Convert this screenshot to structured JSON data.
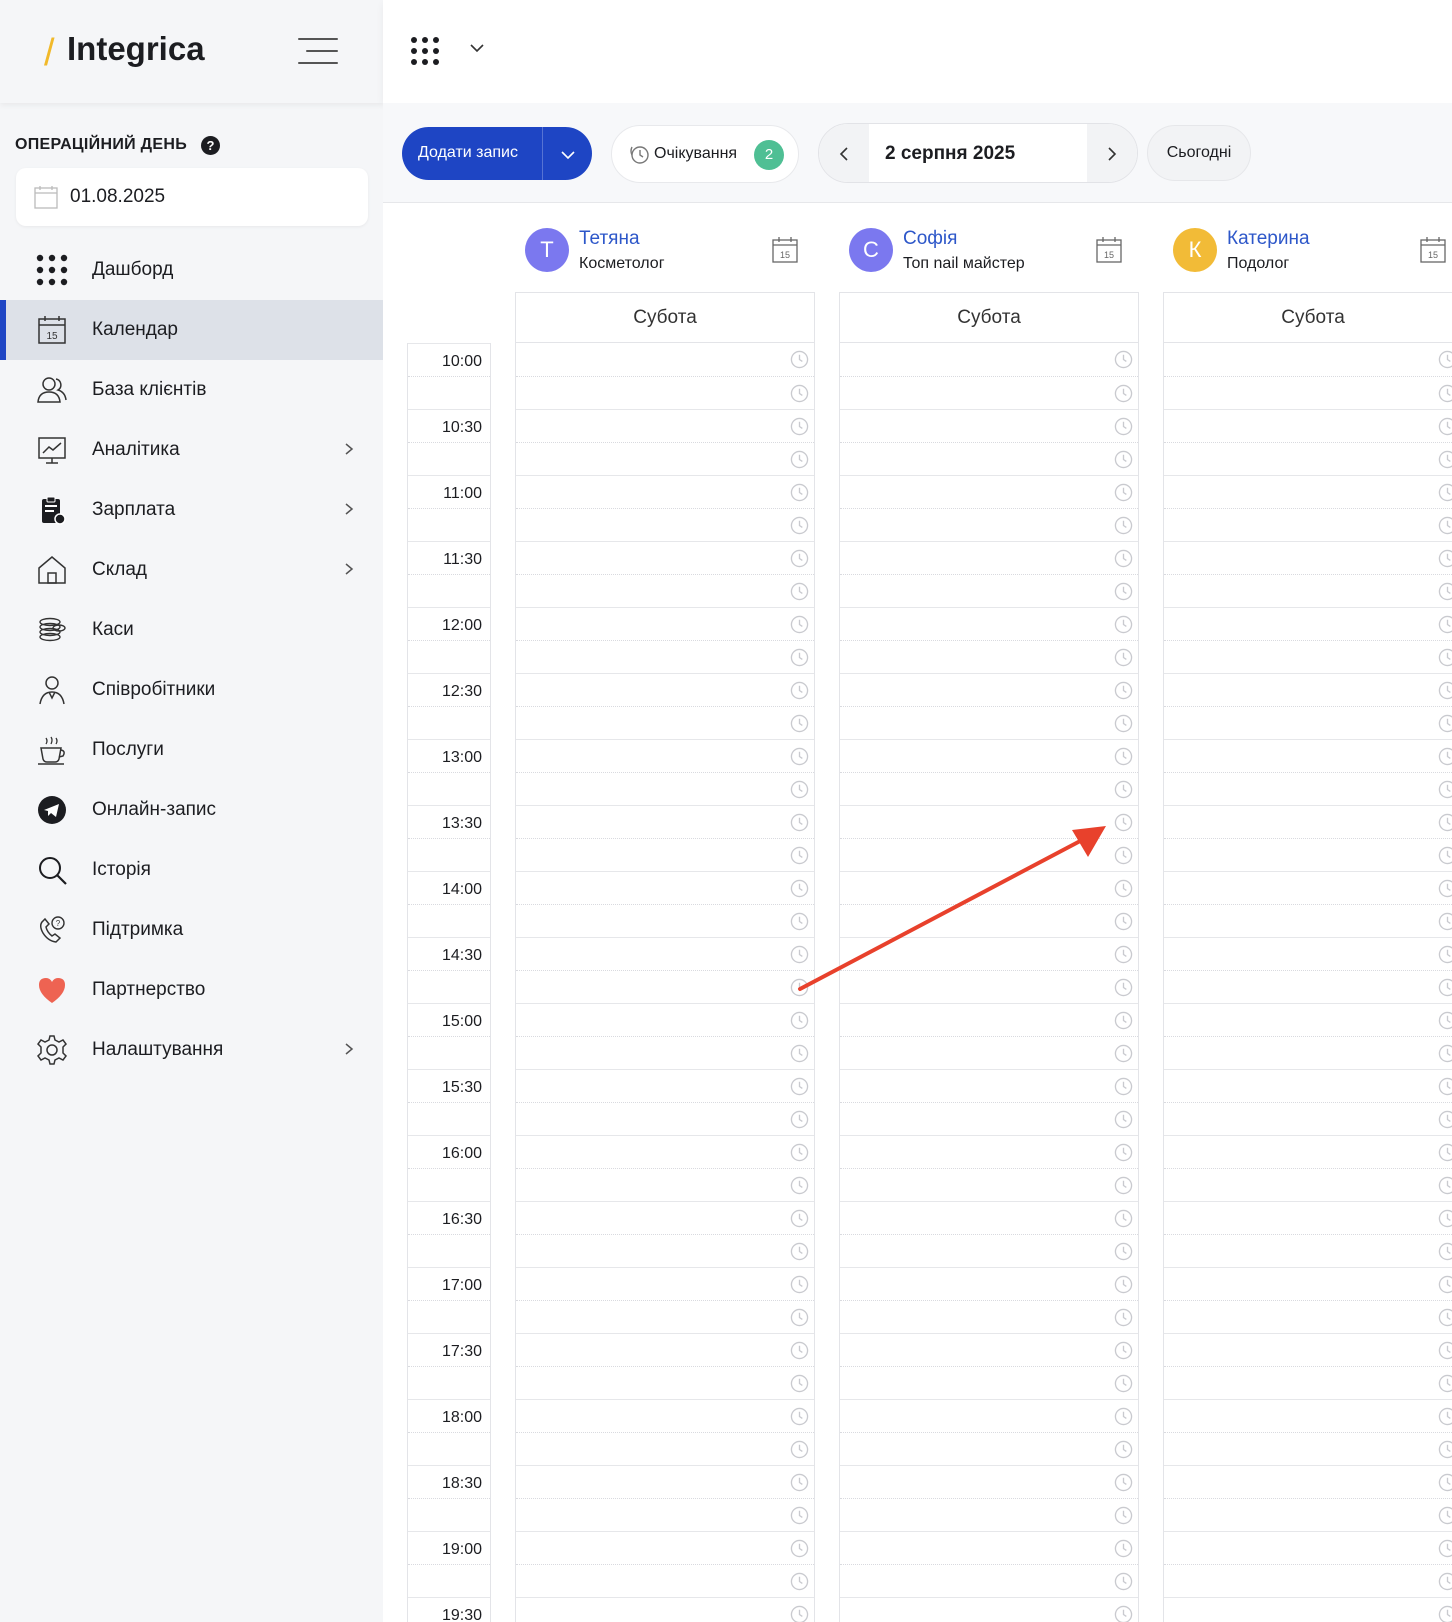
{
  "app": {
    "brand_slash": "/",
    "brand_name": "Integrica"
  },
  "sidebar": {
    "op_day_label": "ОПЕРАЦІЙНИЙ ДЕНЬ",
    "op_day_help": "?",
    "op_day_value": "01.08.2025",
    "items": [
      {
        "label": "Дашборд",
        "icon": "dashboard-dots-icon",
        "active": false,
        "chevron": false
      },
      {
        "label": "Календар",
        "icon": "calendar-icon",
        "active": true,
        "chevron": false
      },
      {
        "label": "База клієнтів",
        "icon": "clients-icon",
        "active": false,
        "chevron": false
      },
      {
        "label": "Аналітика",
        "icon": "analytics-icon",
        "active": false,
        "chevron": true
      },
      {
        "label": "Зарплата",
        "icon": "salary-icon",
        "active": false,
        "chevron": true
      },
      {
        "label": "Склад",
        "icon": "warehouse-icon",
        "active": false,
        "chevron": true
      },
      {
        "label": "Каси",
        "icon": "coins-icon",
        "active": false,
        "chevron": false
      },
      {
        "label": "Співробітники",
        "icon": "employees-icon",
        "active": false,
        "chevron": false
      },
      {
        "label": "Послуги",
        "icon": "coffee-cup-icon",
        "active": false,
        "chevron": false
      },
      {
        "label": "Онлайн-запис",
        "icon": "telegram-icon",
        "active": false,
        "chevron": false
      },
      {
        "label": "Історія",
        "icon": "search-icon",
        "active": false,
        "chevron": false
      },
      {
        "label": "Підтримка",
        "icon": "phone-question-icon",
        "active": false,
        "chevron": false
      },
      {
        "label": "Партнерство",
        "icon": "heart-icon",
        "active": false,
        "chevron": false
      },
      {
        "label": "Налаштування",
        "icon": "gear-icon",
        "active": false,
        "chevron": true
      }
    ]
  },
  "toolbar": {
    "add_label": "Додати запис",
    "waiting_label": "Очікування",
    "waiting_count": "2",
    "current_date": "2 серпня 2025",
    "today_label": "Сьогодні"
  },
  "calendar": {
    "times": [
      "10:00",
      "10:30",
      "11:00",
      "11:30",
      "12:00",
      "12:30",
      "13:00",
      "13:30",
      "14:00",
      "14:30",
      "15:00",
      "15:30",
      "16:00",
      "16:30",
      "17:00",
      "17:30",
      "18:00",
      "18:30",
      "19:00",
      "19:30"
    ],
    "employees": [
      {
        "initial": "Т",
        "name": "Тетяна",
        "role": "Косметолог",
        "day": "Субота",
        "color": "#7b78ef"
      },
      {
        "initial": "С",
        "name": "Софія",
        "role": "Топ nail майстер",
        "day": "Субота",
        "color": "#7b78ef"
      },
      {
        "initial": "К",
        "name": "Катерина",
        "role": "Подолог",
        "day": "Субота",
        "color": "#f2bb37"
      }
    ]
  },
  "colors": {
    "accent": "#1e45c4",
    "badge": "#4fbf94",
    "annotation_arrow": "#e8412c",
    "link": "#2d57c9"
  }
}
